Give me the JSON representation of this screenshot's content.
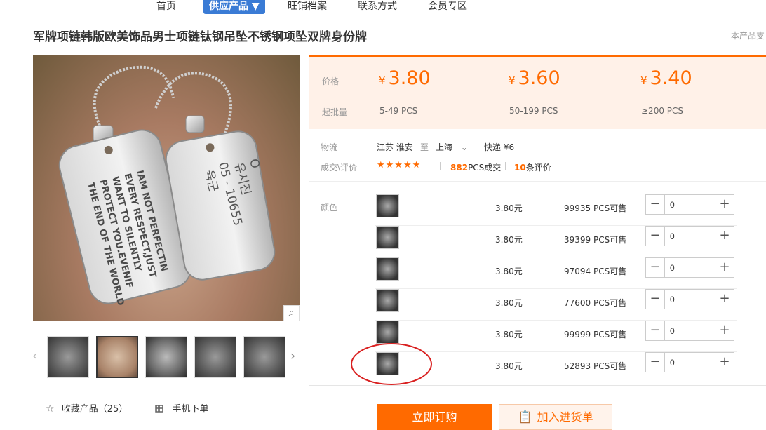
{
  "nav": {
    "items": [
      "首页",
      "供应产品 ▼",
      "旺铺档案",
      "联系方式",
      "会员专区"
    ]
  },
  "product": {
    "title": "军牌项链韩版欧美饰品男士项链钛钢吊坠不锈钢项坠双牌身份牌",
    "side_note": "本产品支"
  },
  "gallery": {
    "tag_left_lines": [
      "IAM NOT PERFECTIN",
      "EVERY RESPECT,JUST",
      "WANT TO SILENTLY",
      "PROTECT YOU.EVENIF",
      "THE END OF THE WORLD"
    ],
    "tag_right_lines": [
      "육군",
      "05 - 10655",
      "유시진",
      "O"
    ],
    "zoom_icon": "magnifier-icon",
    "prev_arrow": "‹",
    "next_arrow": "›"
  },
  "actions": {
    "favorite_icon": "star-outline-icon",
    "favorite_label": "收藏产品（25）",
    "mobile_icon": "qrcode-icon",
    "mobile_label": "手机下单"
  },
  "pricing": {
    "price_label": "价格",
    "moq_label": "起批量",
    "currency": "¥",
    "tiers": [
      {
        "price": "3.80",
        "range": "5-49 PCS"
      },
      {
        "price": "3.60",
        "range": "50-199 PCS"
      },
      {
        "price": "3.40",
        "range": "≥200 PCS"
      }
    ],
    "accent_color": "#ff6a00"
  },
  "logistics": {
    "label": "物流",
    "from": "江苏 淮安",
    "to_word": "至",
    "dest": "上海",
    "dest_chevron": "⌄",
    "shipping": "快递 ¥6"
  },
  "reviews": {
    "label": "成交\\评价",
    "stars": "★★★★★",
    "rating_stars": 4.5,
    "sold_count": "882",
    "sold_suffix": "PCS成交",
    "review_count": "10",
    "review_suffix": "条评价"
  },
  "sku": {
    "label": "颜色",
    "rows": [
      {
        "price": "3.80元",
        "stock": "99935 PCS可售",
        "qty": "0"
      },
      {
        "price": "3.80元",
        "stock": "39399 PCS可售",
        "qty": "0"
      },
      {
        "price": "3.80元",
        "stock": "97094 PCS可售",
        "qty": "0"
      },
      {
        "price": "3.80元",
        "stock": "77600 PCS可售",
        "qty": "0"
      },
      {
        "price": "3.80元",
        "stock": "99999 PCS可售",
        "qty": "0"
      },
      {
        "price": "3.80元",
        "stock": "52893 PCS可售",
        "qty": "0"
      }
    ],
    "minus": "−",
    "plus": "+"
  },
  "buttons": {
    "buy_now": "立即订购",
    "add_to_list": "加入进货单",
    "add_icon": "clipboard-icon"
  }
}
